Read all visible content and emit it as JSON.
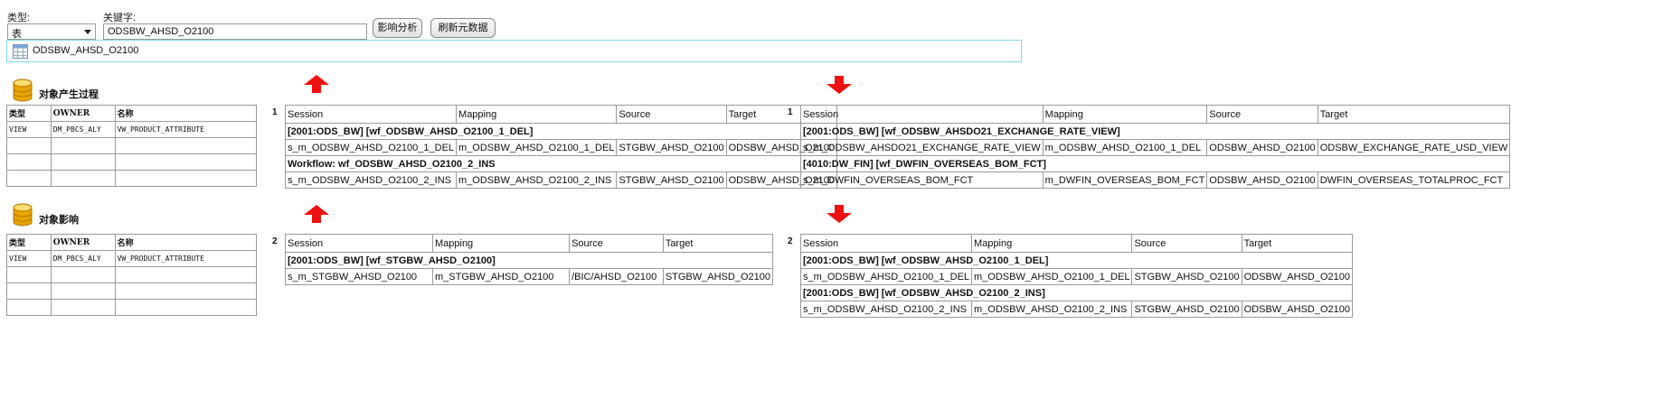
{
  "top": {
    "type_label": "类型:",
    "type_value": "表",
    "keyword_label": "关键字:",
    "keyword_value": "ODSBW_AHSD_O2100",
    "impact_button": "影响分析",
    "refresh_button": "刷新元数据"
  },
  "object_bar": {
    "name": "ODSBW_AHSD_O2100"
  },
  "produce": {
    "title": "对象产生过程",
    "headers": [
      "类型",
      "OWNER",
      "名称"
    ],
    "row": [
      "VIEW",
      "DM_PBCS_ALY",
      "VW_PRODUCT_ATTRIBUTE"
    ]
  },
  "influence": {
    "title": "对象影响",
    "headers": [
      "类型",
      "OWNER",
      "名称"
    ],
    "row": [
      "VIEW",
      "DM_PBCS_ALY",
      "VW_PRODUCT_ATTRIBUTE"
    ]
  },
  "upstream": [
    {
      "num": "1",
      "headers": [
        "Session",
        "Mapping",
        "Source",
        "Target"
      ],
      "groups": [
        {
          "title": "[2001:ODS_BW] [wf_ODSBW_AHSD_O2100_1_DEL]",
          "row": [
            "s_m_ODSBW_AHSD_O2100_1_DEL",
            "m_ODSBW_AHSD_O2100_1_DEL",
            "STGBW_AHSD_O2100",
            "ODSBW_AHSD_O2100"
          ]
        },
        {
          "title": "Workflow: wf_ODSBW_AHSD_O2100_2_INS",
          "row": [
            "s_m_ODSBW_AHSD_O2100_2_INS",
            "m_ODSBW_AHSD_O2100_2_INS",
            "STGBW_AHSD_O2100",
            "ODSBW_AHSD_O2100"
          ]
        }
      ]
    },
    {
      "num": "2",
      "headers": [
        "Session",
        "Mapping",
        "Source",
        "Target"
      ],
      "groups": [
        {
          "title": "[2001:ODS_BW] [wf_STGBW_AHSD_O2100]",
          "row": [
            "s_m_STGBW_AHSD_O2100",
            "m_STGBW_AHSD_O2100",
            "/BIC/AHSD_O2100",
            "STGBW_AHSD_O2100"
          ]
        }
      ]
    }
  ],
  "downstream": [
    {
      "num": "1",
      "headers": [
        "Session",
        "Mapping",
        "Source",
        "Target"
      ],
      "groups": [
        {
          "title": "[2001:ODS_BW] [wf_ODSBW_AHSDO21_EXCHANGE_RATE_VIEW]",
          "row": [
            "s_m_ODSBW_AHSDO21_EXCHANGE_RATE_VIEW",
            "m_ODSBW_AHSD_O2100_1_DEL",
            "ODSBW_AHSD_O2100",
            "ODSBW_EXCHANGE_RATE_USD_VIEW"
          ]
        },
        {
          "title": "[4010:DW_FIN] [wf_DWFIN_OVERSEAS_BOM_FCT]",
          "row": [
            "s_m_DWFIN_OVERSEAS_BOM_FCT",
            "m_DWFIN_OVERSEAS_BOM_FCT",
            "ODSBW_AHSD_O2100",
            "DWFIN_OVERSEAS_TOTALPROC_FCT"
          ]
        }
      ]
    },
    {
      "num": "2",
      "headers": [
        "Session",
        "Mapping",
        "Source",
        "Target"
      ],
      "groups": [
        {
          "title": "[2001:ODS_BW] [wf_ODSBW_AHSD_O2100_1_DEL]",
          "row": [
            "s_m_ODSBW_AHSD_O2100_1_DEL",
            "m_ODSBW_AHSD_O2100_1_DEL",
            "STGBW_AHSD_O2100",
            "ODSBW_AHSD_O2100"
          ]
        },
        {
          "title": "[2001:ODS_BW] [wf_ODSBW_AHSD_O2100_2_INS]",
          "row": [
            "s_m_ODSBW_AHSD_O2100_2_INS",
            "m_ODSBW_AHSD_O2100_2_INS",
            "STGBW_AHSD_O2100",
            "ODSBW_AHSD_O2100"
          ]
        }
      ]
    }
  ],
  "colors": {
    "arrow": "#ee1111",
    "object_bar_border": "#7fd6e6",
    "db_icon": "#e9a400"
  }
}
